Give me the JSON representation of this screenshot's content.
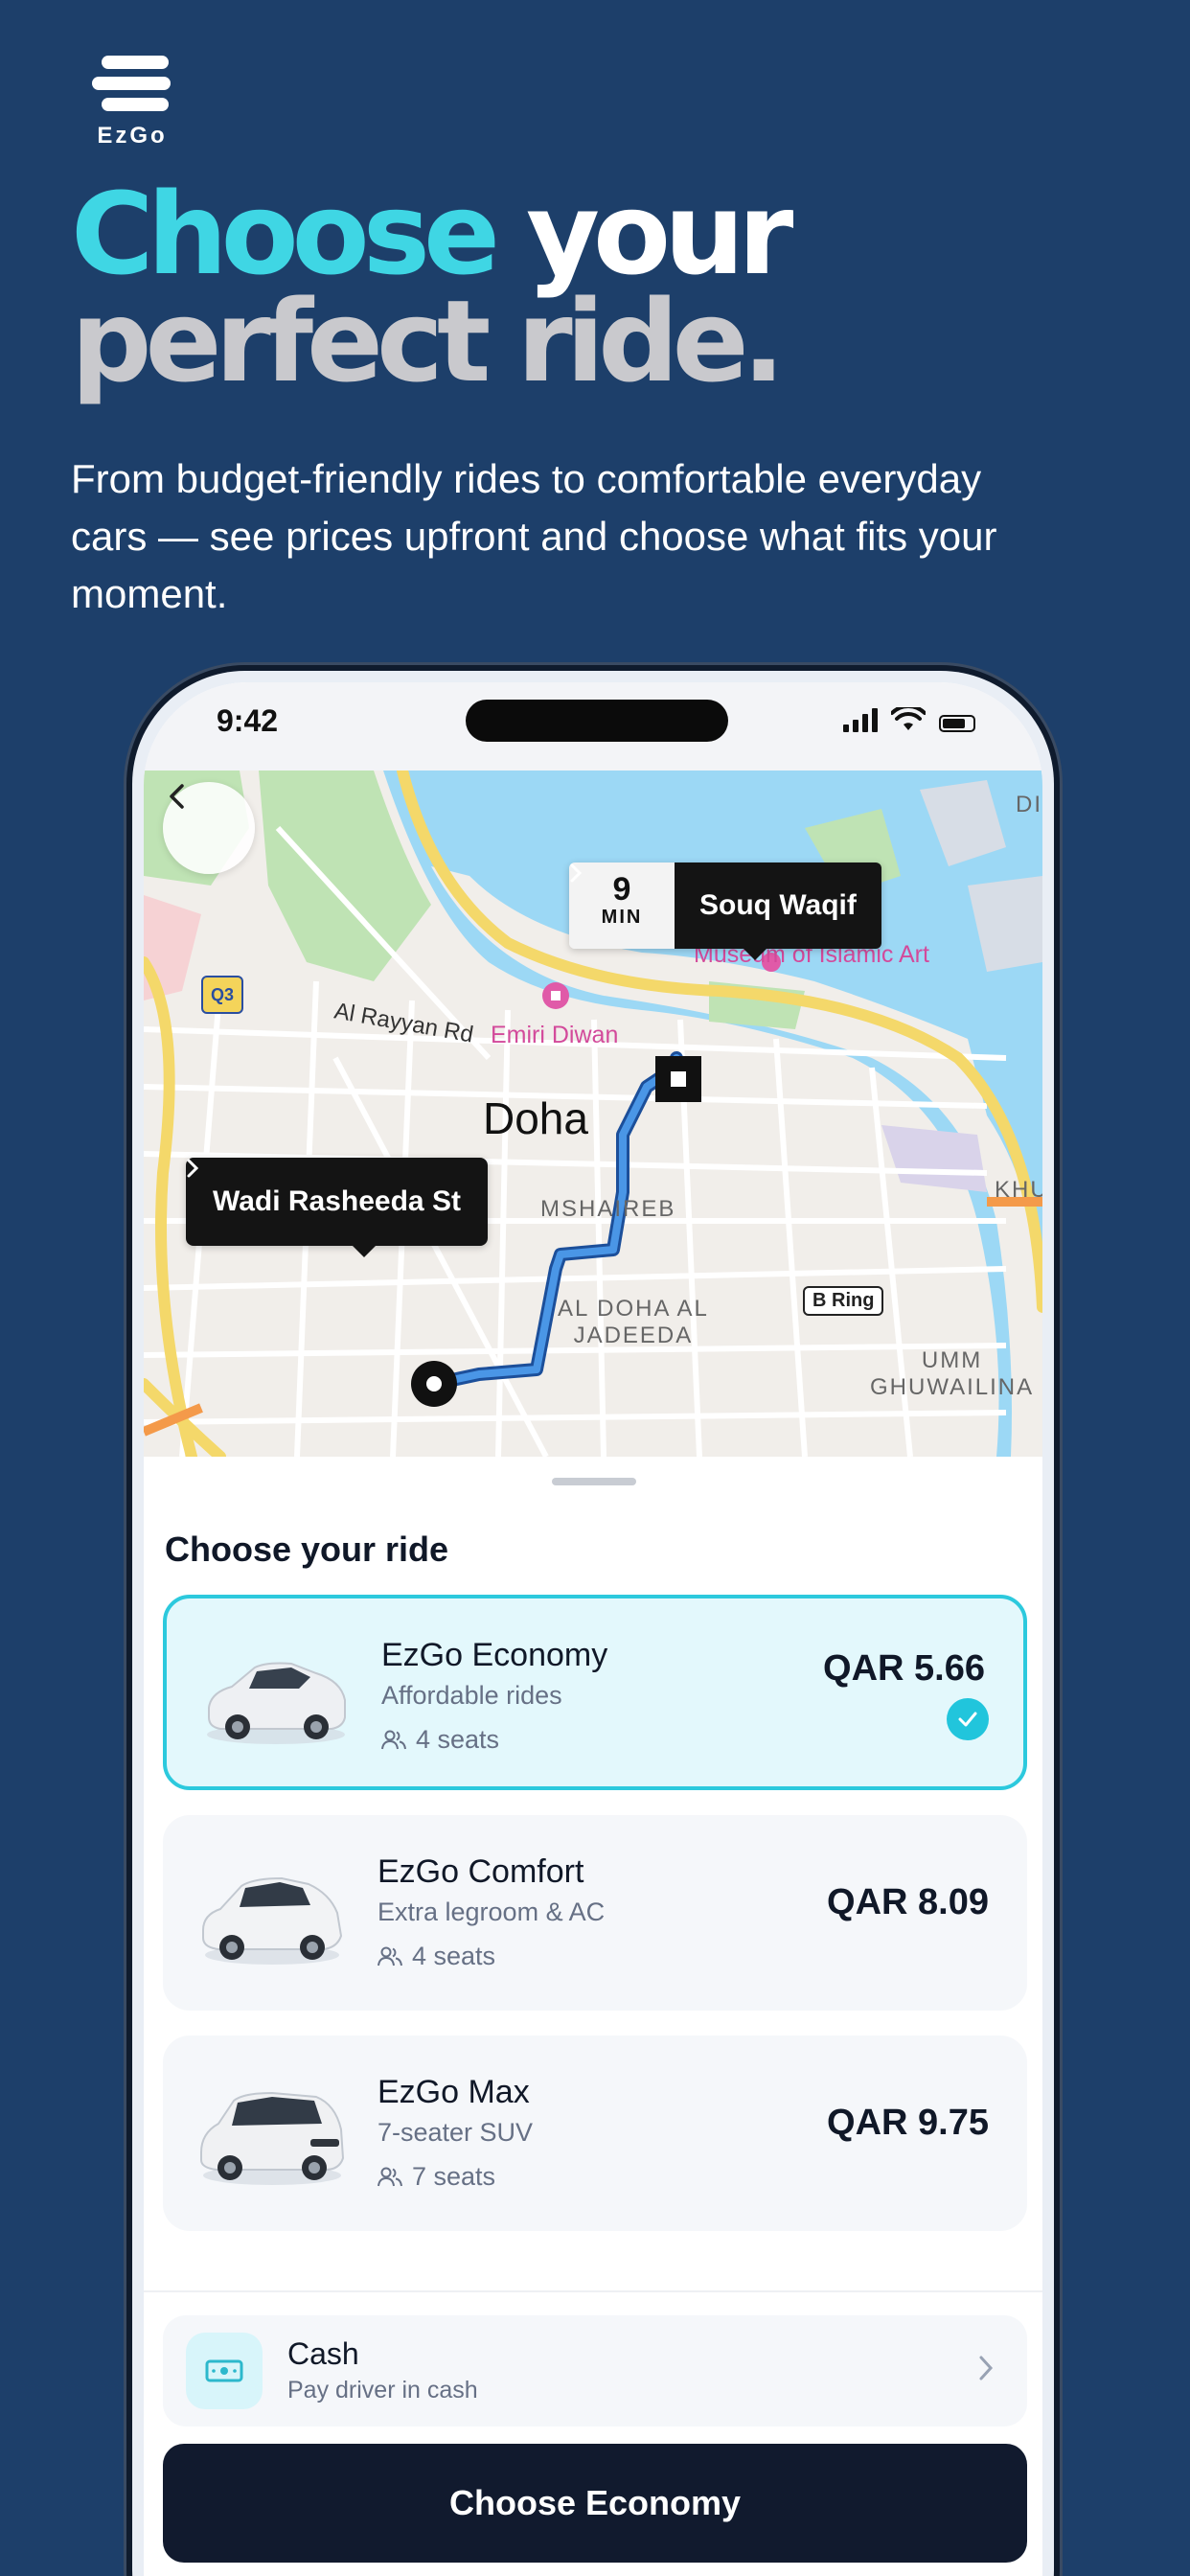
{
  "brand": {
    "logo_text": "EzGo"
  },
  "headline": {
    "word1": "Choose",
    "word2": "your",
    "line2": "perfect ride."
  },
  "subcopy": "From budget-friendly rides to comfortable everyday cars — see prices upfront and choose what fits your moment.",
  "status_bar": {
    "time": "9:42"
  },
  "map": {
    "eta_value": "9",
    "eta_unit": "MIN",
    "destination": "Souq Waqif",
    "origin": "Wadi Rasheeda St",
    "labels": {
      "city": "Doha",
      "rayyan": "Al Rayyan Rd",
      "emiri": "Emiri Diwan",
      "museum": "Museum of Islamic Art",
      "mushaireb": "MSHAIREB",
      "jadeeda_1": "AL DOHA AL",
      "jadeeda_2": "JADEEDA",
      "ghuwailina_1": "UMM",
      "ghuwailina_2": "GHUWAILINA",
      "khu": "KHU",
      "di": "DI",
      "b_ring": "B Ring",
      "q3": "Q3"
    }
  },
  "sheet": {
    "title": "Choose your ride",
    "rides": [
      {
        "name": "EzGo Economy",
        "description": "Affordable rides",
        "seats": "4 seats",
        "price": "QAR 5.66",
        "selected": true
      },
      {
        "name": "EzGo Comfort",
        "description": "Extra legroom & AC",
        "seats": "4 seats",
        "price": "QAR 8.09",
        "selected": false
      },
      {
        "name": "EzGo Max",
        "description": "7-seater SUV",
        "seats": "7 seats",
        "price": "QAR 9.75",
        "selected": false
      }
    ],
    "payment": {
      "title": "Cash",
      "subtitle": "Pay driver in cash"
    },
    "cta_label": "Choose Economy"
  },
  "colors": {
    "background": "#1d3f6a",
    "accent_cyan": "#3fd6e4",
    "selected_border": "#2cc9dd",
    "cta": "#111a2e",
    "route": "#3d86d6"
  }
}
